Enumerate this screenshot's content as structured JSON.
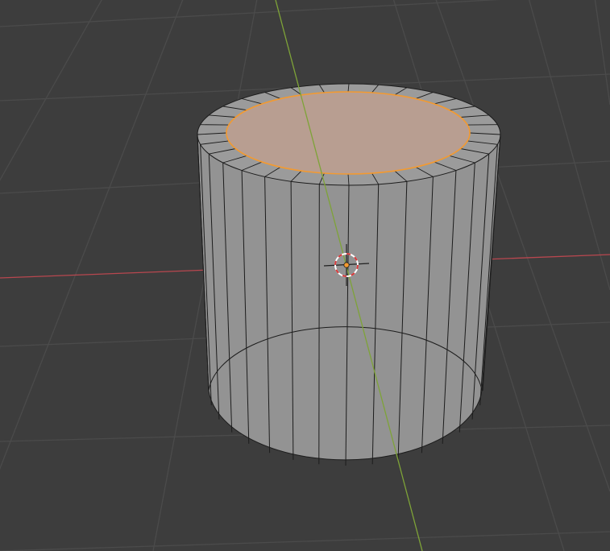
{
  "viewport": {
    "background": "#3d3d3d",
    "grid_color": "#4b4b4b",
    "x_axis_color": "#b8474f",
    "y_axis_color": "#7ea338"
  },
  "object": {
    "shape": "cylinder",
    "segments": 32,
    "face_color": "#939393",
    "edge_color": "#1c1c1c",
    "selected_face_color": "#c9a08a",
    "selection_outline_color": "#f39a30"
  },
  "cursor": {
    "icon": "3d-cursor-icon"
  }
}
